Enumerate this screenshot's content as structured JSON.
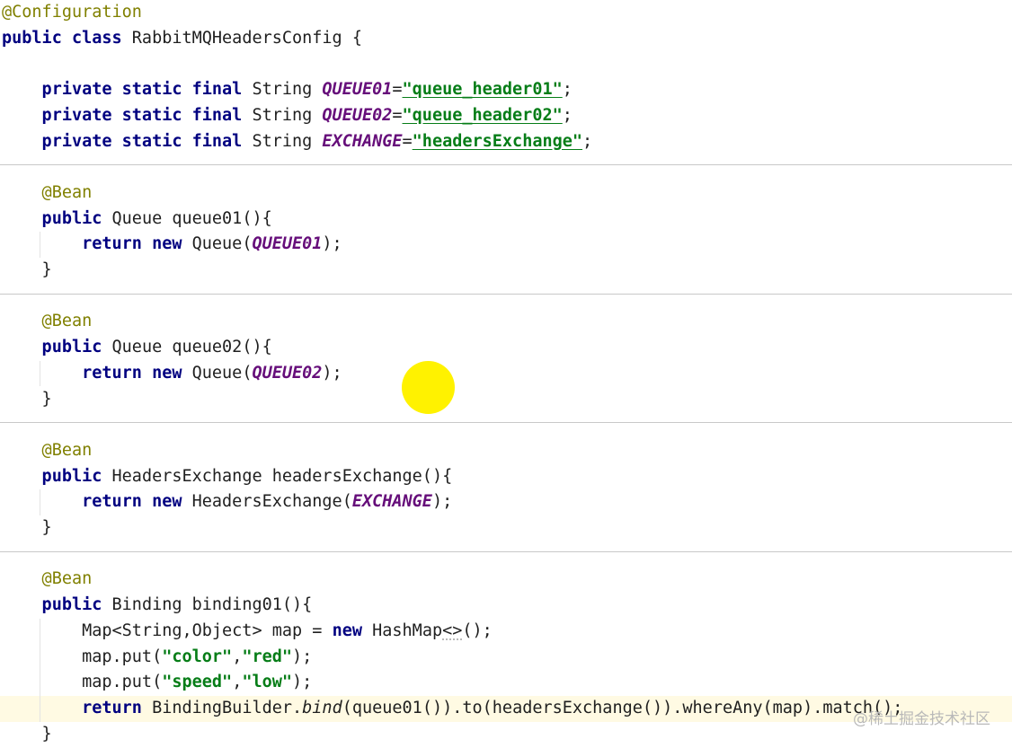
{
  "editor": {
    "language": "java",
    "current_line_index": 27,
    "lines": [
      [
        {
          "t": "@Configuration",
          "k": "ann"
        }
      ],
      [
        {
          "t": "public class ",
          "k": "kw"
        },
        {
          "t": "RabbitMQHeadersConfig {",
          "k": "plain"
        }
      ],
      [],
      [
        {
          "t": "    private static final ",
          "k": "kw"
        },
        {
          "t": "String ",
          "k": "plain"
        },
        {
          "t": "QUEUE01",
          "k": "field"
        },
        {
          "t": "=",
          "k": "plain"
        },
        {
          "t": "\"queue_header01\"",
          "k": "str-link"
        },
        {
          "t": ";",
          "k": "plain"
        }
      ],
      [
        {
          "t": "    private static final ",
          "k": "kw"
        },
        {
          "t": "String ",
          "k": "plain"
        },
        {
          "t": "QUEUE02",
          "k": "field"
        },
        {
          "t": "=",
          "k": "plain"
        },
        {
          "t": "\"queue_header02\"",
          "k": "str-link"
        },
        {
          "t": ";",
          "k": "plain"
        }
      ],
      [
        {
          "t": "    private static final ",
          "k": "kw"
        },
        {
          "t": "String ",
          "k": "plain"
        },
        {
          "t": "EXCHANGE",
          "k": "field"
        },
        {
          "t": "=",
          "k": "plain"
        },
        {
          "t": "\"headersExchange\"",
          "k": "str-link"
        },
        {
          "t": ";",
          "k": "plain"
        }
      ],
      [],
      [
        {
          "t": "    @Bean",
          "k": "ann"
        }
      ],
      [
        {
          "t": "    public ",
          "k": "kw"
        },
        {
          "t": "Queue queue01(){",
          "k": "plain"
        }
      ],
      [
        {
          "t": "        return new ",
          "k": "kw"
        },
        {
          "t": "Queue(",
          "k": "plain"
        },
        {
          "t": "QUEUE01",
          "k": "field"
        },
        {
          "t": ");",
          "k": "plain"
        }
      ],
      [
        {
          "t": "    }",
          "k": "plain"
        }
      ],
      [],
      [
        {
          "t": "    @Bean",
          "k": "ann"
        }
      ],
      [
        {
          "t": "    public ",
          "k": "kw"
        },
        {
          "t": "Queue queue02(){",
          "k": "plain"
        }
      ],
      [
        {
          "t": "        return new ",
          "k": "kw"
        },
        {
          "t": "Queue(",
          "k": "plain"
        },
        {
          "t": "QUEUE02",
          "k": "field"
        },
        {
          "t": ");",
          "k": "plain"
        }
      ],
      [
        {
          "t": "    }",
          "k": "plain"
        }
      ],
      [],
      [
        {
          "t": "    @Bean",
          "k": "ann"
        }
      ],
      [
        {
          "t": "    public ",
          "k": "kw"
        },
        {
          "t": "HeadersExchange headersExchange(){",
          "k": "plain"
        }
      ],
      [
        {
          "t": "        return new ",
          "k": "kw"
        },
        {
          "t": "HeadersExchange(",
          "k": "plain"
        },
        {
          "t": "EXCHANGE",
          "k": "field"
        },
        {
          "t": ");",
          "k": "plain"
        }
      ],
      [
        {
          "t": "    }",
          "k": "plain"
        }
      ],
      [],
      [
        {
          "t": "    @Bean",
          "k": "ann"
        }
      ],
      [
        {
          "t": "    public ",
          "k": "kw"
        },
        {
          "t": "Binding binding01(){",
          "k": "plain"
        }
      ],
      [
        {
          "t": "        Map<String,Object> map = ",
          "k": "plain"
        },
        {
          "t": "new ",
          "k": "kw"
        },
        {
          "t": "HashMap",
          "k": "plain"
        },
        {
          "t": "<>",
          "k": "typo"
        },
        {
          "t": "();",
          "k": "plain"
        }
      ],
      [
        {
          "t": "        map.put(",
          "k": "plain"
        },
        {
          "t": "\"color\"",
          "k": "str"
        },
        {
          "t": ",",
          "k": "plain"
        },
        {
          "t": "\"red\"",
          "k": "str"
        },
        {
          "t": ");",
          "k": "plain"
        }
      ],
      [
        {
          "t": "        map.put(",
          "k": "plain"
        },
        {
          "t": "\"speed\"",
          "k": "str"
        },
        {
          "t": ",",
          "k": "plain"
        },
        {
          "t": "\"low\"",
          "k": "str"
        },
        {
          "t": ");",
          "k": "plain"
        }
      ],
      [
        {
          "t": "        return ",
          "k": "kw"
        },
        {
          "t": "BindingBuilder.",
          "k": "plain"
        },
        {
          "t": "bind",
          "k": "static-call"
        },
        {
          "t": "(queue01()).to(headersExchange()).whereAny(map).match();",
          "k": "plain"
        }
      ],
      [
        {
          "t": "    }",
          "k": "plain"
        }
      ]
    ]
  },
  "watermark": {
    "text": "@稀土掘金技术社区"
  },
  "colors": {
    "keyword": "#000080",
    "annotation": "#808000",
    "constant_field": "#660e7a",
    "string": "#067d17",
    "current_line_bg": "#fffae3",
    "cursor_highlight": "#fff200"
  }
}
